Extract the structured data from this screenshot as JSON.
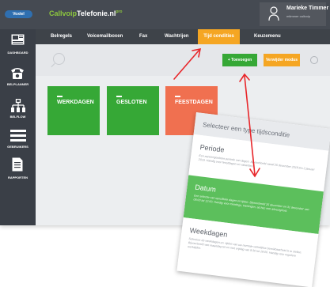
{
  "topbar": {
    "logo": "Voxtel",
    "brand_prefix": "Callvoip",
    "brand_suffix": "Telefonie.nl",
    "brand_sup": "pro",
    "user_name": "Marieke Timmer",
    "user_sub": "mtimmer callvoip"
  },
  "sidebar": {
    "items": [
      {
        "label": "DASHBOARD",
        "icon": "keyboard-screen-icon"
      },
      {
        "label": "BELPLANNER",
        "icon": "telephone-icon"
      },
      {
        "label": "BELFLOW",
        "icon": "hierarchy-icon"
      },
      {
        "label": "GEBRUIKERS",
        "icon": "list-icon"
      },
      {
        "label": "RAPPORTEN",
        "icon": "document-icon"
      }
    ]
  },
  "nav": {
    "tabs": [
      "Belregels",
      "Voicemailboxen",
      "Fax",
      "Wachtrijen",
      "Tijd condities",
      "Keuzemenu"
    ],
    "active_tab": "Tijd condities"
  },
  "toolbar": {
    "add_label": "+ Toevoegen",
    "delete_label": "Verwijder modus"
  },
  "cards": [
    {
      "label": "WERKDAGEN",
      "color": "#36a836"
    },
    {
      "label": "GESLOTEN",
      "color": "#36a836"
    },
    {
      "label": "FEESTDAGEN",
      "color": "#f07050"
    }
  ],
  "modal": {
    "title": "Selecteer een type tijdsconditie",
    "options": [
      {
        "title": "Periode",
        "desc": "Een aaneengesloten periode van dagen. Bijvoorbeeld vanaf 25 december 2018 t/m 2 januari 2019. Handig voor feestdagen en vakanties.",
        "highlighted": false
      },
      {
        "title": "Datum",
        "desc": "Een selectie van specifieke dagen en tijden. Bijvoorbeeld 25 december en 31 december van 08:00 tot 12:00. Handig voor meetings, trainingen, ad hoc een afwezigheid.",
        "highlighted": true
      },
      {
        "title": "Weekdagen",
        "desc": "Selecteer de weekdagen en -tijden van uw normale wekelijkse bereikbaarheid in te stellen. Bijvoorbeeld van maandag tot en met vrijdag van 8:30 tot 18:00. Handig voor reguliere werktijden.",
        "highlighted": false
      }
    ]
  },
  "colors": {
    "accent_green": "#36a836",
    "accent_orange": "#f5a623",
    "accent_red": "#f07050",
    "arrow_red": "#e8262a"
  }
}
